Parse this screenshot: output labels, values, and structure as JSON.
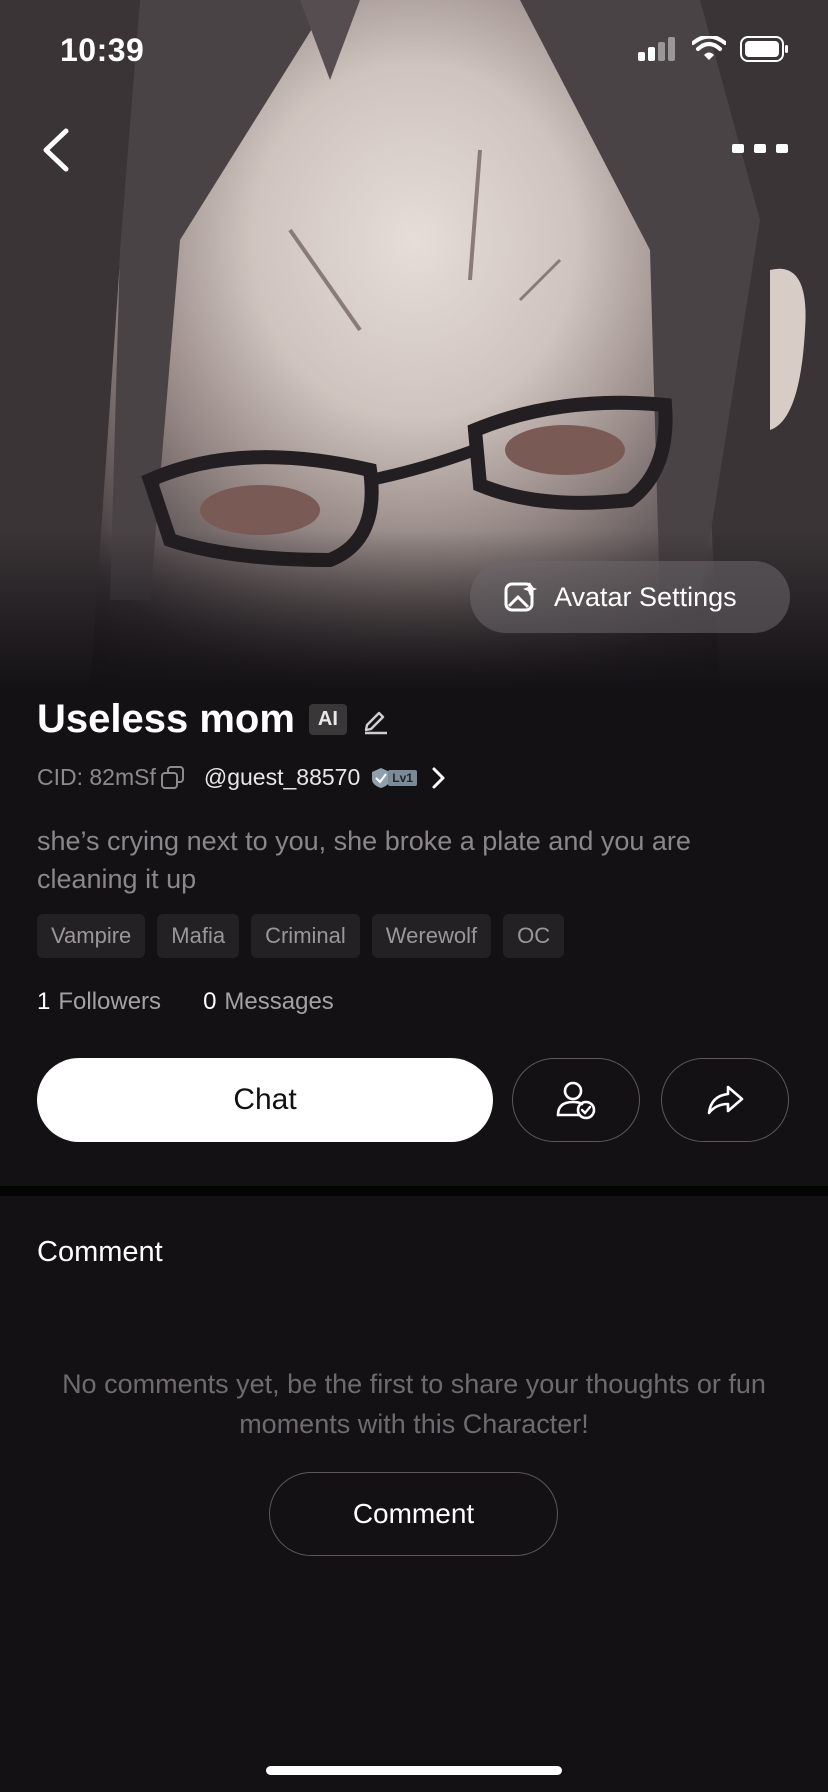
{
  "status_bar": {
    "time": "10:39"
  },
  "hero": {
    "avatar_settings_label": "Avatar Settings"
  },
  "character": {
    "name": "Useless mom",
    "ai_badge": "AI",
    "cid": "CID: 82mSf",
    "creator_handle": "@guest_88570",
    "creator_level": "Lv1",
    "description": "she’s crying next to you, she broke a plate and you are cleaning it up",
    "tags": [
      "Vampire",
      "Mafia",
      "Criminal",
      "Werewolf",
      "OC"
    ]
  },
  "stats": {
    "followers_count": "1",
    "followers_label": "Followers",
    "messages_count": "0",
    "messages_label": "Messages"
  },
  "actions": {
    "chat_label": "Chat"
  },
  "comments": {
    "title": "Comment",
    "empty_message": "No comments yet, be the first to share your thoughts or fun moments with this Character!",
    "button_label": "Comment"
  },
  "icons": [
    "back-icon",
    "more-icon",
    "avatar-settings-icon",
    "edit-icon",
    "copy-icon",
    "level-badge-icon",
    "chevron-right-icon",
    "follow-user-icon",
    "share-icon",
    "signal-icon",
    "wifi-icon",
    "battery-icon"
  ]
}
